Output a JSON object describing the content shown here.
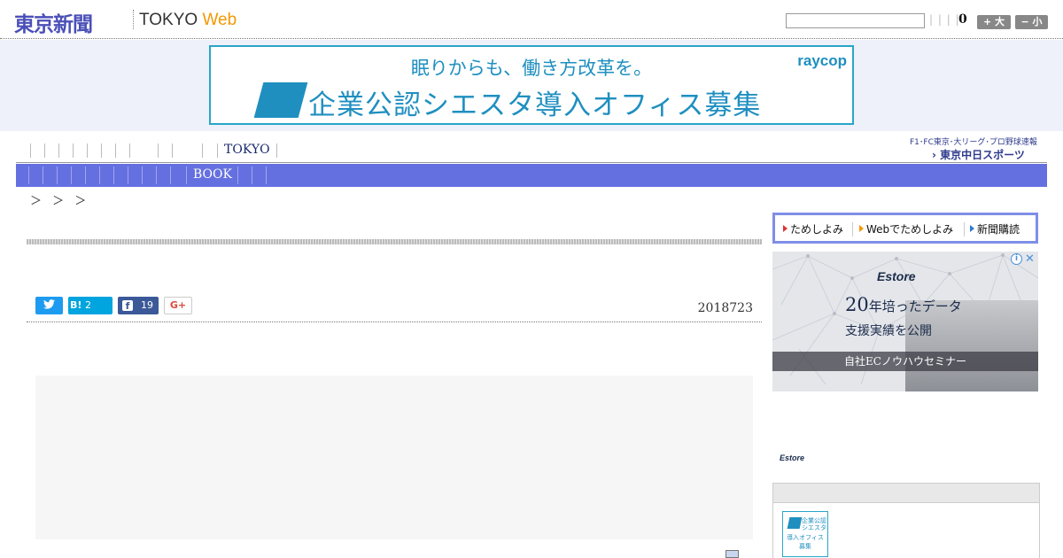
{
  "header": {
    "logo_jp": "東京新聞",
    "logo_en_main": "TOKYO",
    "logo_en_accent": "Web",
    "search_value": "",
    "pipes": "| | | |",
    "counter": "0",
    "font_bigger": "+ 大",
    "font_smaller": "− 小"
  },
  "banner": {
    "line1": "眠りからも、働き方改革を。",
    "line2": "企業公認シエスタ導入オフィス募集",
    "brand": "raycop"
  },
  "nav": {
    "primary_active": "TOKYO",
    "secondary_active": "BOOK",
    "sports_text": "F1･FC東京･大リーグ･プロ野球速報",
    "sports_logo": "› 東京中日スポーツ"
  },
  "breadcrumb": "＞ ＞ ＞",
  "article": {
    "date": "2018723",
    "share": {
      "hatena_label": "B!",
      "hatena_count": "2",
      "facebook_count": "19",
      "gplus_label": "G+"
    }
  },
  "sidebar": {
    "subscribe": [
      "ためしよみ",
      "Webでためしよみ",
      "新聞購読"
    ],
    "ad": {
      "brand": "Estore",
      "head_big": "20",
      "head_rest": "年培ったデータ",
      "sub": "支援実績を公開",
      "strip": "自社ECノウハウセミナー",
      "info": "i",
      "close": "✕"
    },
    "ad2_logo": "Estore",
    "thumb": {
      "line1": "企業公認\nシエスタ",
      "line2": "導入オフィス\n募集"
    }
  },
  "colors": {
    "brand_blue": "#4a4fb8",
    "nav_blue": "#6570e0",
    "web_orange": "#f39800",
    "banner_cyan": "#1f8fc0"
  }
}
